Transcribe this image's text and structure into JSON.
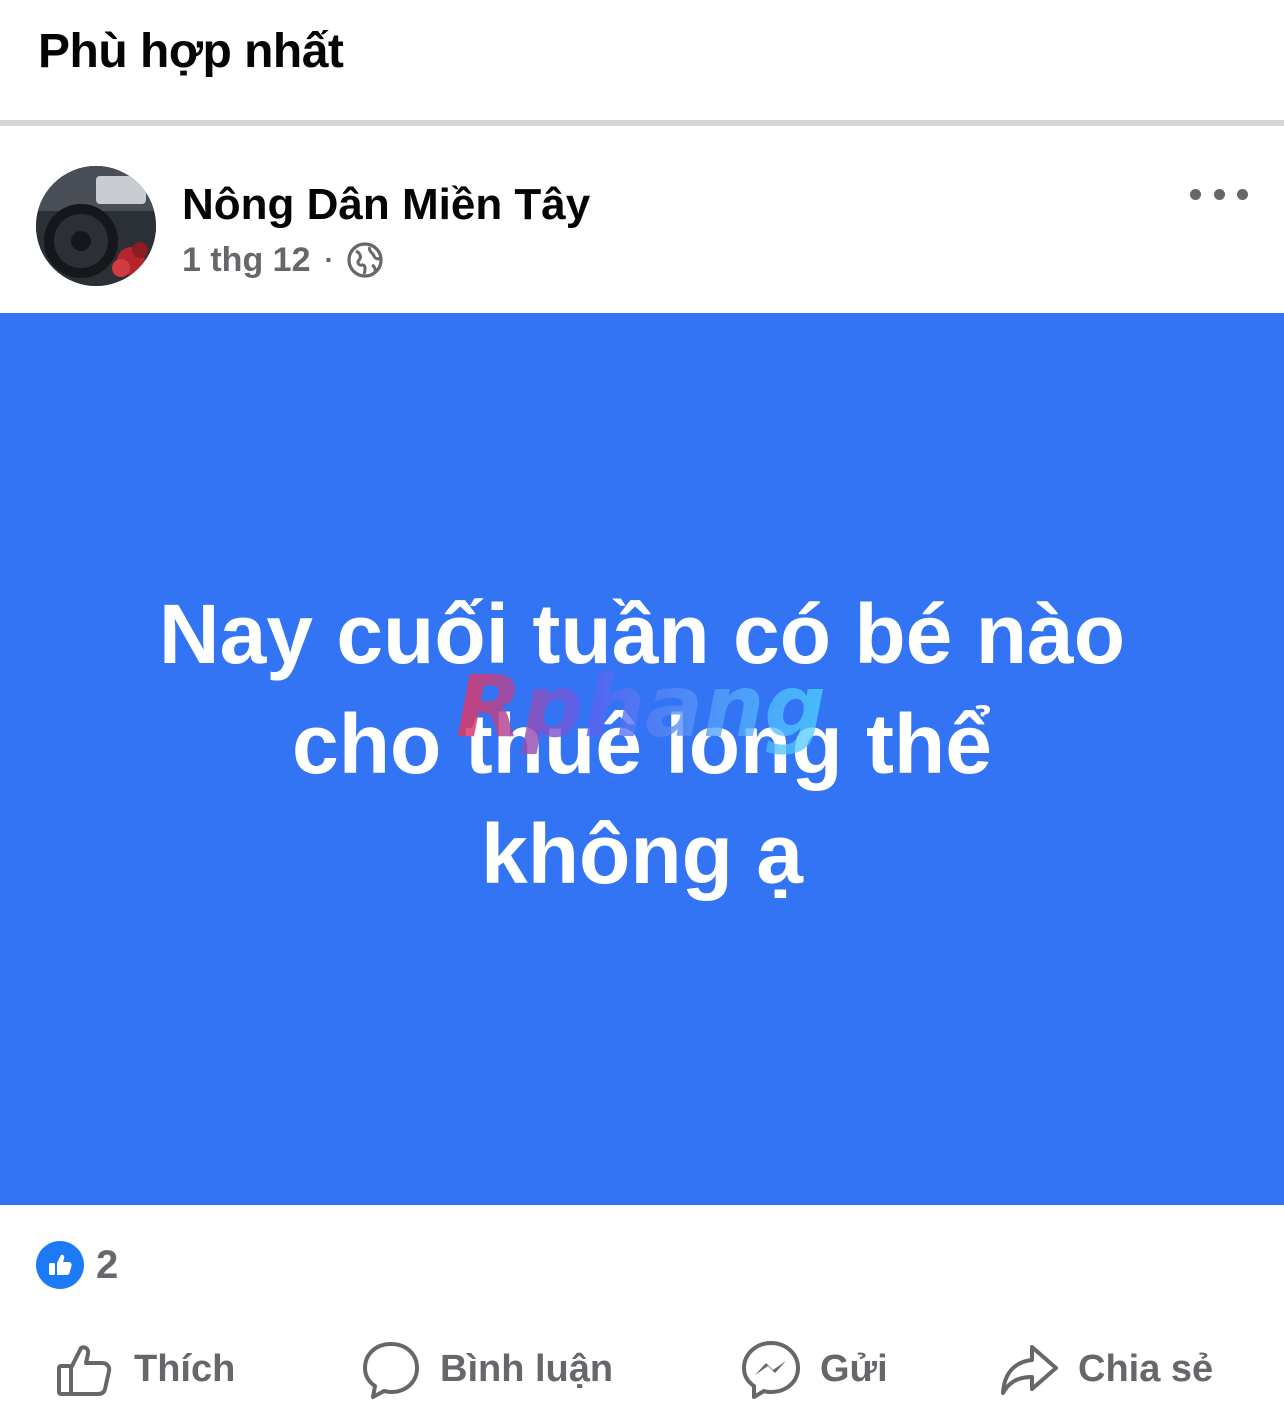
{
  "header": {
    "title": "Phù hợp nhất"
  },
  "post": {
    "author": "Nông Dân Miền Tây",
    "time": "1 thg 12",
    "separator": "·",
    "privacy_icon": "globe-icon",
    "text": "Nay cuối tuần có bé nào\ncho thuê long thể\nkhông ạ",
    "background_color": "#3274f3",
    "watermark": "Rphang",
    "reaction_icon": "like-badge-icon",
    "reaction_count": "2"
  },
  "actions": {
    "like": "Thích",
    "comment": "Bình luận",
    "send": "Gửi",
    "share": "Chia sẻ"
  }
}
